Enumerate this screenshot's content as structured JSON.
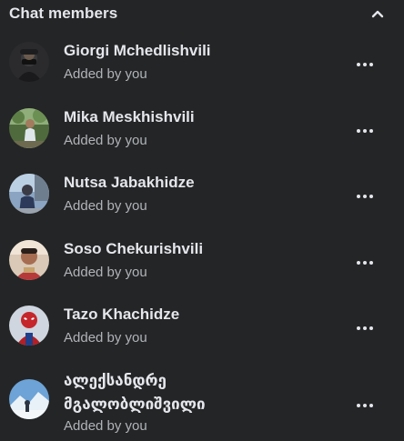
{
  "section": {
    "title": "Chat members",
    "collapse_icon": "chevron-up-icon"
  },
  "members": [
    {
      "name": "Giorgi Mchedlishvili",
      "subtitle": "Added by you"
    },
    {
      "name": "Mika Meskhishvili",
      "subtitle": "Added by you"
    },
    {
      "name": "Nutsa Jabakhidze",
      "subtitle": "Added by you"
    },
    {
      "name": "Soso Chekurishvili",
      "subtitle": "Added by you"
    },
    {
      "name": "Tazo Khachidze",
      "subtitle": "Added by you"
    },
    {
      "name": "ალექსანდრე მგალობლიშვილი",
      "subtitle": "Added by you"
    }
  ],
  "more_icon": "more-horizontal-icon",
  "colors": {
    "background": "#242526",
    "primary_text": "#e4e6eb",
    "secondary_text": "#b0b3b8"
  }
}
